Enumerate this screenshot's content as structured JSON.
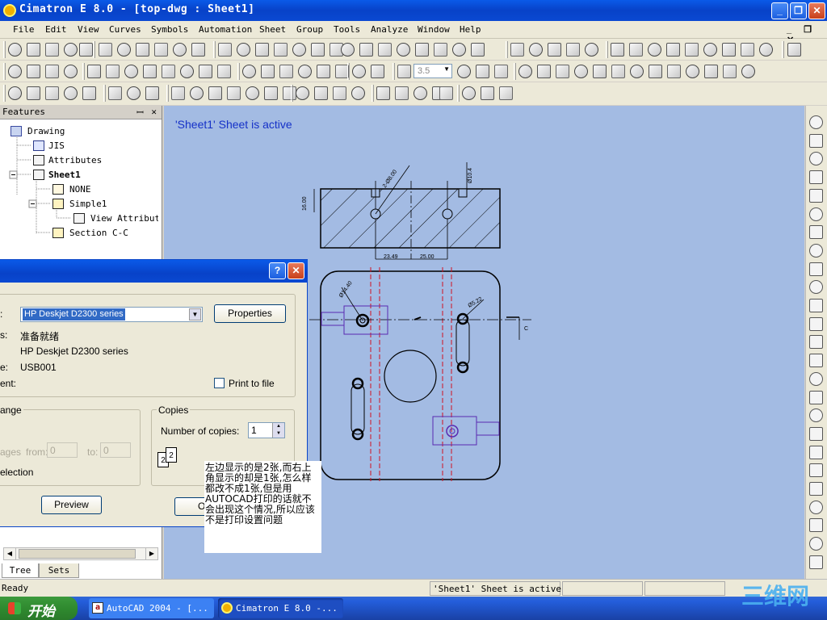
{
  "window": {
    "title": "Cimatron E 8.0 - [top-dwg : Sheet1]",
    "minimize": "_",
    "restore": "❐",
    "close": "✕"
  },
  "menu": {
    "items": [
      "File",
      "Edit",
      "View",
      "Curves",
      "Symbols",
      "Automation",
      "Sheet",
      "Group",
      "Tools",
      "Analyze",
      "Window",
      "Help"
    ],
    "mdi_controls": "_ ❐ ✕"
  },
  "toolbar": {
    "scale_value": "3.5"
  },
  "features_panel": {
    "title": "Features",
    "pin": "ꟷ",
    "close": "✕",
    "tree": [
      {
        "label": "Drawing",
        "indent": 0,
        "bold": false
      },
      {
        "label": "JIS",
        "indent": 1,
        "bold": false
      },
      {
        "label": "Attributes",
        "indent": 1,
        "bold": false
      },
      {
        "label": "Sheet1",
        "indent": 1,
        "bold": true
      },
      {
        "label": "NONE",
        "indent": 2,
        "bold": false
      },
      {
        "label": "Simple1",
        "indent": 2,
        "bold": false
      },
      {
        "label": "View Attributes",
        "indent": 3,
        "bold": false
      },
      {
        "label": "Section C-C",
        "indent": 2,
        "bold": false
      }
    ],
    "tabs": [
      "Tree",
      "Sets"
    ]
  },
  "canvas": {
    "active_message": "'Sheet1' Sheet is active",
    "dims": {
      "d1": "23.49",
      "d2": "25.00",
      "d3": "16.00",
      "d4": "2-Ø8.00",
      "d5": "Ø10.4",
      "d6": "Ø14.40",
      "d7": "Ø5.22",
      "section_label": "C"
    }
  },
  "print_dialog": {
    "help": "?",
    "close": "✕",
    "printer_name": "HP Deskjet D2300 series",
    "properties": "Properties",
    "status_label": "s:",
    "status_value": "准备就绪",
    "type_value": "HP Deskjet D2300 series",
    "where_label": "e:",
    "where_value": "USB001",
    "comment_label": "ent:",
    "print_to_file": "Print to file",
    "range_title": "ange",
    "pages_label": "ages",
    "from_label": "from:",
    "from_value": "0",
    "to_label": "to:",
    "to_value": "0",
    "selection_label": "election",
    "copies_title": "Copies",
    "num_copies_label": "Number of copies:",
    "num_copies_value": "1",
    "collate_icon_1": "2",
    "collate_icon_2": "2",
    "preview": "Preview",
    "ok_partial": "O"
  },
  "note": "左边显示的是2张,而右上角显示的却是1张,怎么样都改不成1张,但是用AUTOCAD打印的话就不会出现这个情况,所以应该不是打印设置问题",
  "status": {
    "left": "Ready",
    "middle": "'Sheet1' Sheet is active"
  },
  "taskbar": {
    "start": "开始",
    "buttons": [
      "AutoCAD 2004 - [...",
      "Cimatron E 8.0 -..."
    ]
  },
  "watermark": "三维网"
}
